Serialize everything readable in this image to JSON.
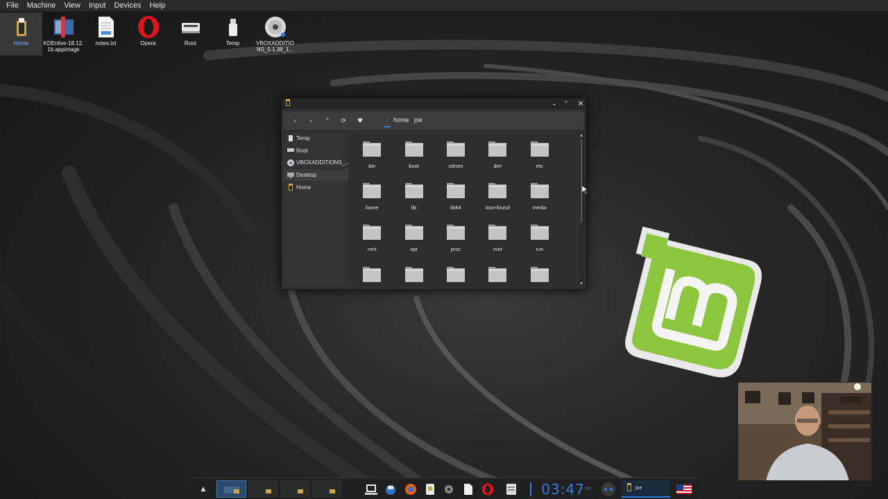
{
  "vbox_menu": [
    "File",
    "Machine",
    "View",
    "Input",
    "Devices",
    "Help"
  ],
  "desktop_icons": [
    {
      "label": "Home",
      "icon": "home-folder-icon"
    },
    {
      "label": "KDEnlive-18.12.1b.appimage",
      "icon": "kdenlive-appimage-icon"
    },
    {
      "label": "notes.txt",
      "icon": "text-file-icon"
    },
    {
      "label": "Opera",
      "icon": "opera-icon"
    },
    {
      "label": "Root",
      "icon": "root-drive-icon"
    },
    {
      "label": "Temp",
      "icon": "temp-drive-icon"
    },
    {
      "label": "VBOXADDITIONS_5.1.38_1...",
      "icon": "cdrom-disc-icon"
    }
  ],
  "file_manager": {
    "breadcrumb_root": "/",
    "breadcrumb": [
      "home",
      "joe"
    ],
    "sidebar": [
      {
        "label": "Temp",
        "icon": "drive-icon"
      },
      {
        "label": "Root",
        "icon": "harddisk-icon"
      },
      {
        "label": "VBOXADDITIONS_...",
        "icon": "cdrom-icon"
      },
      {
        "label": "Desktop",
        "icon": "desktop-icon"
      },
      {
        "label": "Home",
        "icon": "home-icon"
      }
    ],
    "files": [
      "bin",
      "boot",
      "cdrom",
      "dev",
      "etc",
      "home",
      "lib",
      "lib64",
      "lost+found",
      "media",
      "mnt",
      "opt",
      "proc",
      "root",
      "run",
      "",
      "",
      "",
      "",
      ""
    ]
  },
  "taskbar": {
    "clock": "03:47",
    "ampm": "PM",
    "active_task": "joe"
  },
  "colors": {
    "accent": "#2f7fe0",
    "mint_green": "#8cc63f"
  }
}
